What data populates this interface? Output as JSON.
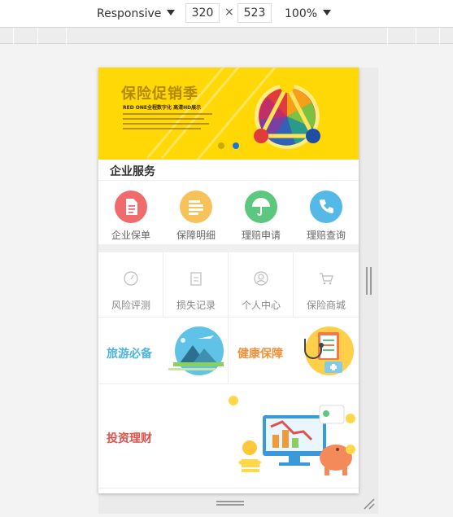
{
  "devtools": {
    "device_mode": "Responsive",
    "width": "320",
    "times": "×",
    "height": "523",
    "zoom": "100%"
  },
  "banner": {
    "title": "保险促销季",
    "subtitle": "RED ONE全程数字化 高清HD展示",
    "active_slide": 2,
    "colors": {
      "background": "#ffd806",
      "dot_inactive": "#c8a900",
      "dot_active": "#1b74d8"
    }
  },
  "section": {
    "title": "企业服务"
  },
  "services": [
    {
      "label": "企业保单",
      "icon": "document-icon",
      "color": "#f06c6c"
    },
    {
      "label": "保障明细",
      "icon": "list-icon",
      "color": "#f7c259"
    },
    {
      "label": "理赔申请",
      "icon": "umbrella-icon",
      "color": "#5cc77e"
    },
    {
      "label": "理赔查询",
      "icon": "phone-icon",
      "color": "#55b9e8"
    }
  ],
  "tools": [
    {
      "label": "风险评测",
      "icon": "gauge-icon"
    },
    {
      "label": "损失记录",
      "icon": "notepad-icon"
    },
    {
      "label": "个人中心",
      "icon": "user-icon"
    },
    {
      "label": "保险商城",
      "icon": "cart-icon"
    }
  ],
  "promos": [
    {
      "label": "旅游必备",
      "color": "#4fb3d9",
      "icon": "travel-illustration-icon"
    },
    {
      "label": "健康保障",
      "color": "#f0923c",
      "icon": "health-illustration-icon"
    },
    {
      "label": "投资理财",
      "color": "#e2504a",
      "icon": "finance-illustration-icon"
    }
  ]
}
